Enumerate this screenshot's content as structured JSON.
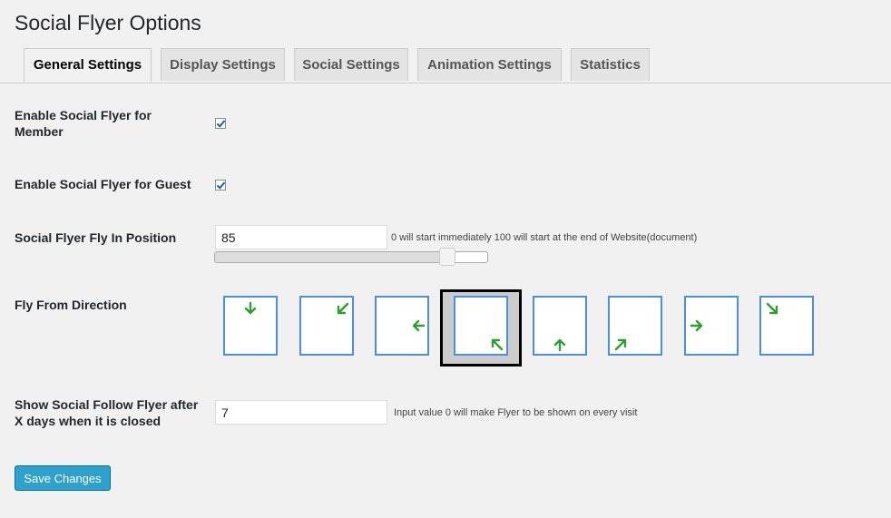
{
  "page": {
    "title": "Social Flyer Options"
  },
  "tabs": [
    {
      "label": "General Settings",
      "active": true
    },
    {
      "label": "Display Settings",
      "active": false
    },
    {
      "label": "Social Settings",
      "active": false
    },
    {
      "label": "Animation Settings",
      "active": false
    },
    {
      "label": "Statistics",
      "active": false
    }
  ],
  "fields": {
    "member": {
      "label": "Enable Social Flyer for Member",
      "checked": true
    },
    "guest": {
      "label": "Enable Social Flyer for Guest",
      "checked": true
    },
    "position": {
      "label": "Social Flyer Fly In Position",
      "value": "85",
      "help": "0 will start immediately 100 will start at the end of Website(document)",
      "slider_percent": 85
    },
    "direction": {
      "label": "Fly From Direction",
      "selected": "bottom-right",
      "options": [
        "top",
        "top-right",
        "right",
        "bottom-right",
        "bottom",
        "bottom-left",
        "left",
        "top-left"
      ],
      "arrow_color": "#2ca02c"
    },
    "days": {
      "label": "Show Social Follow Flyer after X days when it is closed",
      "value": "7",
      "help": "Input value 0 will make Flyer to be shown on every visit"
    }
  },
  "actions": {
    "save_label": "Save Changes"
  },
  "colors": {
    "accent": "#2ea2cc",
    "box_border": "#4a90e2",
    "selected_bg": "#cccccc"
  }
}
